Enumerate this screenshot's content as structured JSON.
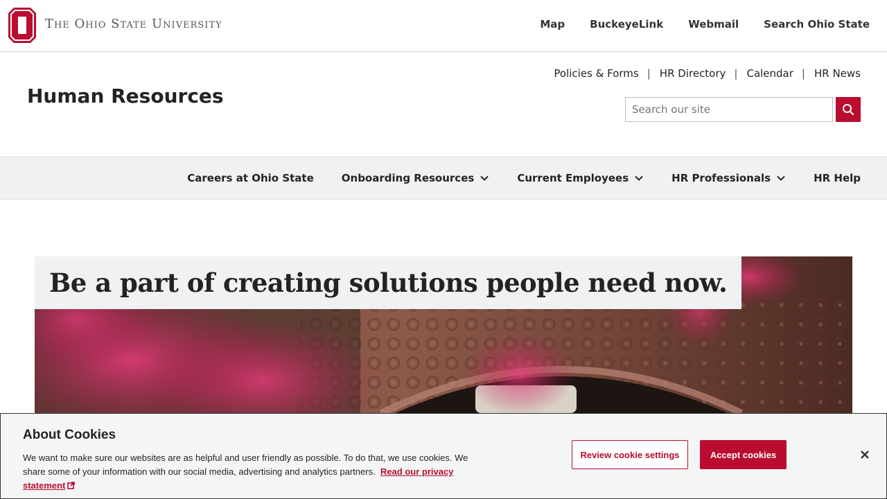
{
  "osu_bar": {
    "wordmark": "The Ohio State University",
    "links": [
      "Map",
      "BuckeyeLink",
      "Webmail",
      "Search Ohio State"
    ]
  },
  "header": {
    "site_title": "Human Resources",
    "utility_links": [
      "Policies & Forms",
      "HR Directory",
      "Calendar",
      "HR News"
    ],
    "search": {
      "placeholder": "Search our site",
      "value": ""
    }
  },
  "nav": {
    "items": [
      {
        "label": "Careers at Ohio State",
        "dropdown": false
      },
      {
        "label": "Onboarding Resources",
        "dropdown": true
      },
      {
        "label": "Current Employees",
        "dropdown": true
      },
      {
        "label": "HR Professionals",
        "dropdown": true
      },
      {
        "label": "HR Help",
        "dropdown": false
      }
    ]
  },
  "hero": {
    "caption": "Be a part of creating solutions people need now."
  },
  "cookie_banner": {
    "title": "About Cookies",
    "text": "We want to make sure our websites are as helpful and user friendly as possible. To do that, we use cookies. We share some of your information with our social media, advertising and analytics partners.",
    "link_label": "Read our privacy statement",
    "review_label": "Review cookie settings",
    "accept_label": "Accept cookies"
  },
  "colors": {
    "scarlet": "#ba0c2f",
    "nav_bg": "#eff1f2",
    "text": "#212325"
  },
  "icons": {
    "logo": "block-o-logo",
    "search": "search-icon",
    "chevron": "chevron-down-icon",
    "external": "external-link-icon",
    "close": "close-icon"
  }
}
